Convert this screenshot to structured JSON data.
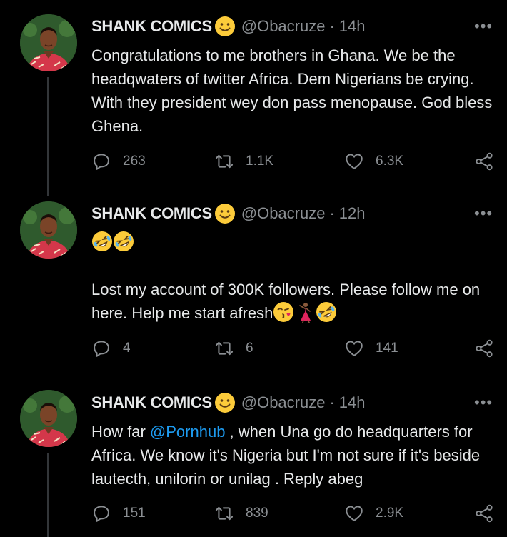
{
  "tweets": [
    {
      "name": "SHANK COMICS",
      "handle": "@Obacruze",
      "time": "14h",
      "text": "Congratulations to me brothers in Ghana. We be the headqwaters of twitter Africa. Dem Nigerians be crying. With they president wey don pass menopause. God bless Ghena.",
      "replies": "263",
      "retweets": "1.1K",
      "likes": "6.3K"
    },
    {
      "name": "SHANK COMICS",
      "handle": "@Obacruze",
      "time": "12h",
      "text": "Lost my account of 300K followers. Please follow me on here. Help me start afresh",
      "replies": "4",
      "retweets": "6",
      "likes": "141"
    },
    {
      "name": "SHANK COMICS",
      "handle": "@Obacruze",
      "time": "14h",
      "mention": "@Pornhub",
      "text_before": "How far ",
      "text_after": " , when Una go do headquarters for Africa. We know it's Nigeria but I'm not sure if it's beside lautecth, unilorin or unilag . Reply abeg",
      "replies": "151",
      "retweets": "839",
      "likes": "2.9K"
    }
  ],
  "separator": "·",
  "more_label": "•••",
  "icons": [
    "reply-icon",
    "retweet-icon",
    "like-icon",
    "share-icon",
    "more-icon",
    "smiling-face-emoji",
    "rolling-laughing-emoji",
    "kissing-face-emoji",
    "dancer-emoji"
  ]
}
